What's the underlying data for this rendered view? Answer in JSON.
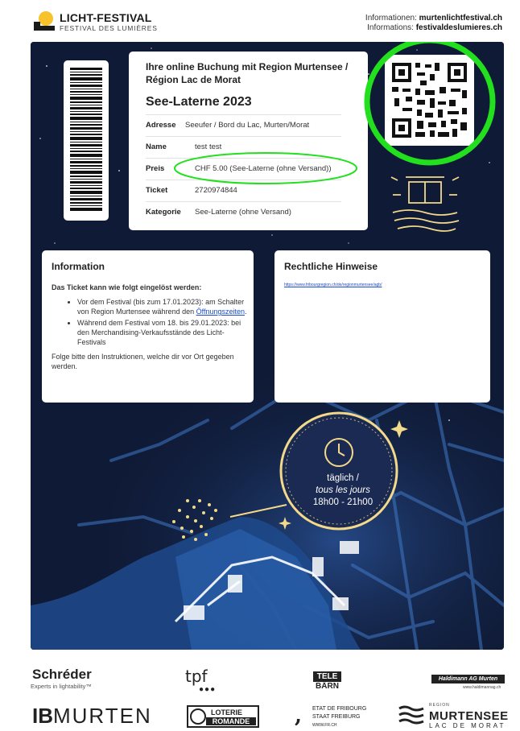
{
  "header": {
    "brand_name": "LICHT-FESTIVAL",
    "brand_sub": "FESTIVAL DES LUMIÈRES",
    "info_de_label": "Informationen:",
    "info_de_url": "murtenlichtfestival.ch",
    "info_fr_label": "Informations:",
    "info_fr_url": "festivaldeslumieres.ch"
  },
  "ticket": {
    "heading": "Ihre online Buchung mit Region Murtensee / Région Lac de Morat",
    "title": "See-Laterne 2023",
    "fields": [
      {
        "label": "Adresse",
        "value": "Seeufer / Bord du Lac, Murten/Morat"
      },
      {
        "label": "Name",
        "value": "test test"
      },
      {
        "label": "Preis",
        "value": "CHF 5.00 (See-Laterne (ohne Versand))"
      },
      {
        "label": "Ticket",
        "value": "2720974844"
      },
      {
        "label": "Kategorie",
        "value": "See-Laterne (ohne Versand)"
      }
    ]
  },
  "information": {
    "title": "Information",
    "intro": "Das Ticket kann wie folgt eingelöst werden:",
    "bullet1_text": "Vor dem Festival (bis zum 17.01.2023): am Schalter von Region Murtensee während den",
    "bullet1_link": "Öffnungszeiten",
    "bullet2_text": "Während dem Festival vom 18. bis 29.01.2023: bei den Merchandising-Verkaufsstände des Licht-Festivals",
    "footer": "Folge bitte den Instruktionen, welche dir vor Ort gegeben werden."
  },
  "legal": {
    "title": "Rechtliche Hinweise",
    "link": "https://www.fribourgregion.ch/de/regionmurtensee/agb/"
  },
  "schedule": {
    "line1": "täglich /",
    "line2": "tous les jours",
    "line3": "18h00 - 21h00"
  },
  "sponsors": {
    "schreder": "Schréder",
    "schreder_tag": "Experts in lightability™",
    "tpf": "tpf",
    "telebarn_1": "TELE",
    "telebarn_2": "BÄRN",
    "haldimann": "Haldimann AG  Murten",
    "haldimann_url": "www.haldimannag.ch",
    "ib_bold": "IB",
    "ib_light": "MURTEN",
    "loterie_1": "LOTERIE",
    "loterie_2": "ROMANDE",
    "fribourg_1": "ETAT DE FRIBOURG",
    "fribourg_2": "STAAT FREIBURG",
    "fribourg_3": "WWW.FR.CH",
    "region_small": "REGION",
    "murtensee": "MURTENSEE",
    "lac_de_morat": "LAC DE MORAT"
  },
  "colors": {
    "poster_bg": "#0f1a36",
    "highlight": "#22e01e",
    "gold": "#f3d98a",
    "link": "#1a4bd0"
  }
}
